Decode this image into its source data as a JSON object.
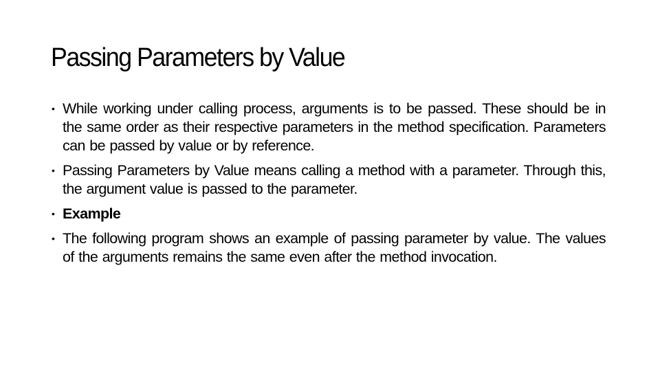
{
  "slide": {
    "title": "Passing Parameters by Value",
    "bullet_glyph": "•",
    "bullets": [
      {
        "text": "While working under calling process, arguments is to be passed. These should be in the same order as their respective parameters in the method specification. Parameters can be passed by value or by reference.",
        "bold": false
      },
      {
        "text": "Passing Parameters by Value means calling a method with a parameter. Through this, the argument value is passed to the parameter.",
        "bold": false
      },
      {
        "text": "Example",
        "bold": true
      },
      {
        "text": "The following program shows an example of passing parameter by value. The values of the arguments remains the same even after the method invocation.",
        "bold": false
      }
    ]
  }
}
